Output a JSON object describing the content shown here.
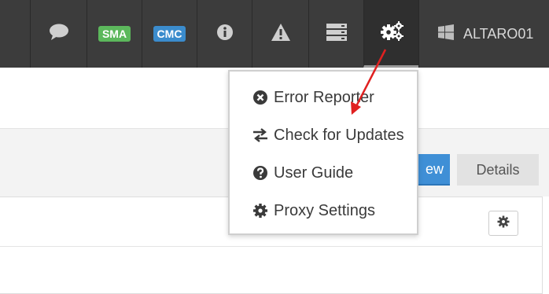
{
  "topbar": {
    "sma_label": "SMA",
    "cmc_label": "CMC",
    "host_name": "ALTARO01",
    "icons": [
      "chat-icon",
      "info-icon",
      "warning-icon",
      "server-icon",
      "settings-cogs-icon",
      "windows-icon"
    ],
    "colors": {
      "bar": "#3c3c3c",
      "sma": "#5cb85c",
      "cmc": "#3b8ccd"
    }
  },
  "tabs": {
    "overview_label": "ew",
    "details_label": "Details"
  },
  "dropdown": {
    "items": [
      {
        "label": "Error Reporter",
        "icon": "times-circle-icon"
      },
      {
        "label": "Check for Updates",
        "icon": "exchange-icon"
      },
      {
        "label": "User Guide",
        "icon": "question-circle-icon"
      },
      {
        "label": "Proxy Settings",
        "icon": "gear-icon"
      }
    ]
  },
  "annotation": {
    "arrow_color": "#e02020"
  }
}
